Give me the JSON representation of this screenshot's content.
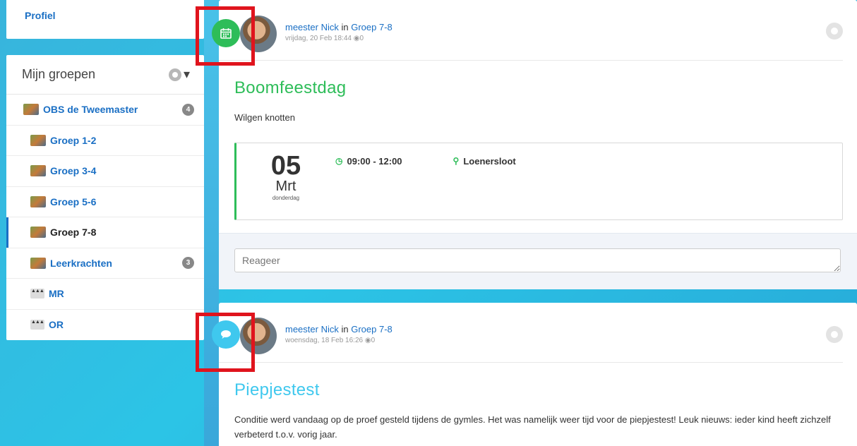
{
  "sidebar": {
    "profile_label": "Profiel",
    "groups_title": "Mijn groepen",
    "items": [
      {
        "label": "OBS de Tweemaster",
        "badge": "4"
      },
      {
        "label": "Groep 1-2",
        "badge": ""
      },
      {
        "label": "Groep 3-4",
        "badge": ""
      },
      {
        "label": "Groep 5-6",
        "badge": ""
      },
      {
        "label": "Groep 7-8",
        "badge": ""
      },
      {
        "label": "Leerkrachten",
        "badge": "3"
      },
      {
        "label": "MR",
        "badge": ""
      },
      {
        "label": "OR",
        "badge": ""
      }
    ]
  },
  "posts": [
    {
      "author": "meester Nick",
      "in_word": "in",
      "group": "Groep 7-8",
      "date": "vrijdag, 20 Feb 18:44",
      "views": "0",
      "title": "Boomfeestdag",
      "text": "Wilgen knotten",
      "event": {
        "day": "05",
        "month": "Mrt",
        "weekday": "donderdag",
        "time": "09:00 - 12:00",
        "location": "Loenersloot"
      },
      "reply_placeholder": "Reageer"
    },
    {
      "author": "meester Nick",
      "in_word": "in",
      "group": "Groep 7-8",
      "date": "woensdag, 18 Feb 16:26",
      "views": "0",
      "title": "Piepjestest",
      "text": "Conditie werd vandaag op de proef gesteld tijdens de gymles. Het was namelijk weer tijd voor de piepjestest! Leuk nieuws: ieder kind heeft zichzelf verbeterd t.o.v. vorig jaar."
    }
  ],
  "colors": {
    "accent_blue": "#1a6fc4",
    "event_green": "#2ebd59",
    "message_blue": "#3fc8ee",
    "highlight_red": "#e0141d"
  },
  "icons": {
    "event_type": "calendar-icon",
    "message_type": "speech-bubble-icon"
  }
}
